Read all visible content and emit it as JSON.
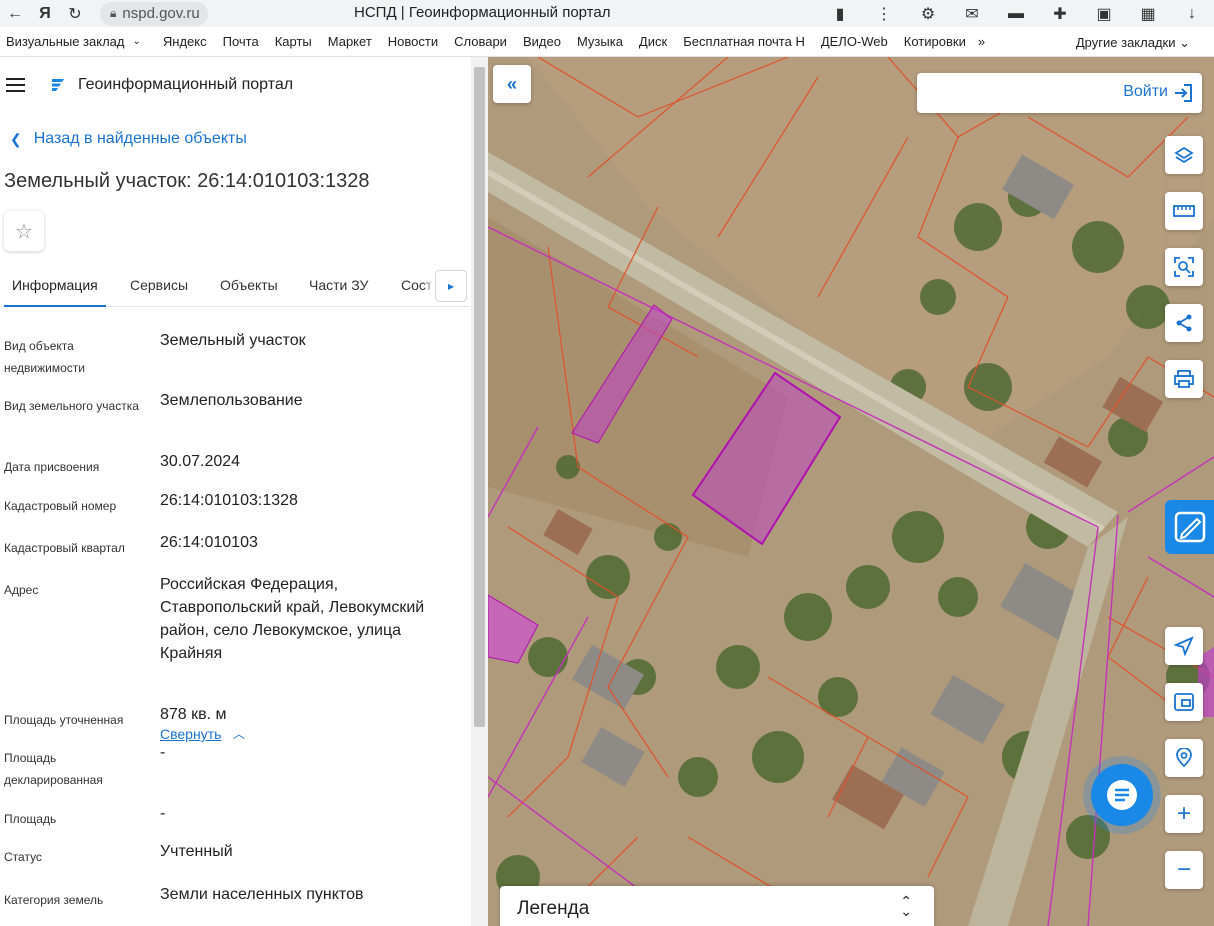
{
  "browser": {
    "url": "nspd.gov.ru",
    "tab_title": "НСПД | Геоинформационный портал",
    "bookmarks": [
      "Визуальные заклад",
      "Яндекс",
      "Почта",
      "Карты",
      "Маркет",
      "Новости",
      "Словари",
      "Видео",
      "Музыка",
      "Диск",
      "Бесплатная почта Н",
      "ДЕЛО-Web",
      "Котировки"
    ],
    "other_bookmarks": "Другие закладки"
  },
  "app": {
    "title": "Геоинформационный портал",
    "back_label": "Назад в найденные объекты",
    "object_title": "Земельный участок: 26:14:010103:1328",
    "tabs": [
      "Информация",
      "Сервисы",
      "Объекты",
      "Части ЗУ",
      "Соста"
    ],
    "active_tab": "Информация",
    "info": [
      {
        "key": "Вид объекта недвижимости",
        "value": "Земельный участок"
      },
      {
        "key": "Вид земельного участка",
        "value": "Землепользование"
      },
      {
        "key": "Дата присвоения",
        "value": "30.07.2024"
      },
      {
        "key": "Кадастровый номер",
        "value": "26:14:010103:1328"
      },
      {
        "key": "Кадастровый квартал",
        "value": "26:14:010103"
      },
      {
        "key": "Адрес",
        "value": "Российская Федерация, Ставропольский край, Левокумский район, село Левокумское, улица Крайняя"
      },
      {
        "key": "Площадь уточненная",
        "value": "878 кв. м"
      },
      {
        "key": "Площадь декларированная",
        "value": "-"
      },
      {
        "key": "Площадь",
        "value": "-"
      },
      {
        "key": "Статус",
        "value": "Учтенный"
      },
      {
        "key": "Категория земель",
        "value": "Земли населенных пунктов"
      }
    ],
    "collapse_label": "Свернуть"
  },
  "map": {
    "login_label": "Войти",
    "legend_label": "Легенда",
    "colors": {
      "accent": "#1a73d1",
      "parcel": "#b030c0",
      "boundary": "#e0522a",
      "road": "#b8b19a"
    }
  }
}
